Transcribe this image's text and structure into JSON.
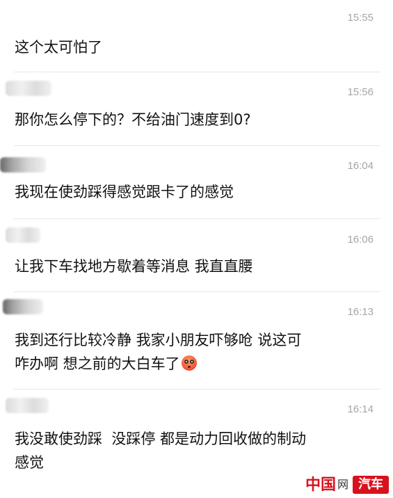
{
  "messages": [
    {
      "time": "15:55",
      "text": "这个太可怕了"
    },
    {
      "time": "15:56",
      "text": "那你怎么停下的？不给油门速度到0?"
    },
    {
      "time": "16:04",
      "text": "我现在使劲踩得感觉跟卡了的感觉"
    },
    {
      "time": "16:06",
      "text": "让我下车找地方歇着等消息 我直直腰"
    },
    {
      "time": "16:13",
      "text": "我到还行比较冷静 我家小朋友吓够呛 说这可\n咋办啊 想之前的大白车了",
      "emoji": "flushed-face-emoji"
    },
    {
      "time": "16:14",
      "text": "我没敢使劲踩  没踩停 都是动力回收做的制动\n感觉"
    }
  ],
  "watermark": {
    "logo": "中国",
    "net": "网",
    "badge": "汽车"
  },
  "colors": {
    "time": "#a6a6a6",
    "text": "#111111",
    "divider": "#e6e6e6",
    "brand_red": "#d7121d"
  }
}
